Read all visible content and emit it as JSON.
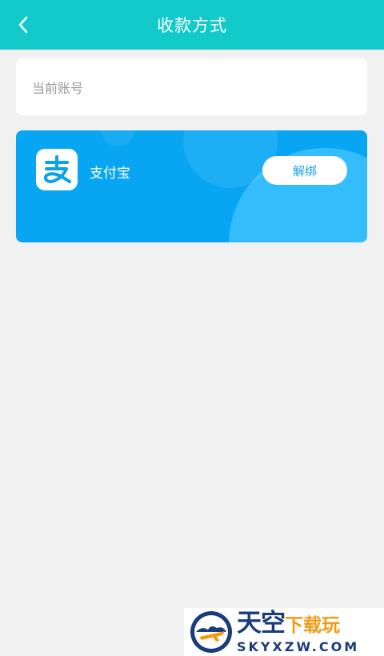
{
  "header": {
    "title": "收款方式",
    "back_icon": "chevron-left-icon",
    "background_color": "#12cac9"
  },
  "account": {
    "label": "当前账号"
  },
  "payment_card": {
    "icon": "alipay-logo-icon",
    "name": "支付宝",
    "unbind_label": "解绑",
    "background_color": "#08a6f2"
  },
  "watermark": {
    "cn_main": "天空",
    "cn_sub": "下载玩",
    "en": "SKYXZW.COM"
  }
}
